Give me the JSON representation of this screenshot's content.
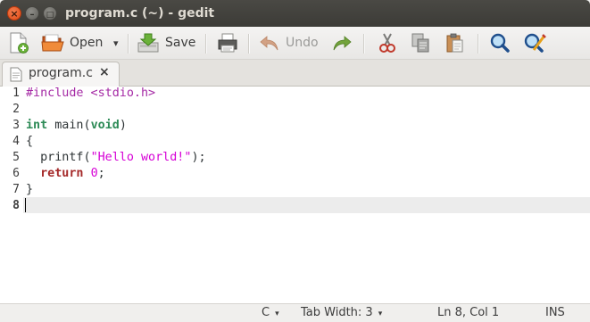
{
  "window": {
    "title": "program.c (~) - gedit",
    "close_glyph": "×",
    "minimize_glyph": "–",
    "maximize_glyph": "□"
  },
  "toolbar": {
    "new_icon": "new-document-icon",
    "open_label": "Open",
    "open_icon": "folder-open-icon",
    "open_dropdown_glyph": "▾",
    "save_label": "Save",
    "save_icon": "save-icon",
    "print_icon": "printer-icon",
    "undo_label": "Undo",
    "undo_icon": "undo-arrow-icon",
    "redo_icon": "redo-arrow-icon",
    "cut_icon": "scissors-icon",
    "copy_icon": "copy-icon",
    "paste_icon": "paste-icon",
    "find_icon": "search-icon",
    "replace_icon": "search-replace-icon"
  },
  "tabs": [
    {
      "label": "program.c",
      "close_glyph": "×",
      "icon": "text-file-icon",
      "active": true
    }
  ],
  "editor": {
    "line_numbers": [
      "1",
      "2",
      "3",
      "4",
      "5",
      "6",
      "7",
      "8"
    ],
    "current_line": "8",
    "lines": [
      {
        "tokens": [
          {
            "t": "#include <stdio.h>",
            "c": "pre"
          }
        ]
      },
      {
        "tokens": []
      },
      {
        "tokens": [
          {
            "t": "int",
            "c": "ty"
          },
          {
            "t": " main(",
            "c": ""
          },
          {
            "t": "void",
            "c": "ty"
          },
          {
            "t": ")",
            "c": ""
          }
        ]
      },
      {
        "tokens": [
          {
            "t": "{",
            "c": ""
          }
        ]
      },
      {
        "tokens": [
          {
            "t": "  printf(",
            "c": ""
          },
          {
            "t": "\"Hello world!\"",
            "c": "str"
          },
          {
            "t": ");",
            "c": ""
          }
        ]
      },
      {
        "tokens": [
          {
            "t": "  ",
            "c": ""
          },
          {
            "t": "return",
            "c": "kw"
          },
          {
            "t": " ",
            "c": ""
          },
          {
            "t": "0",
            "c": "num"
          },
          {
            "t": ";",
            "c": ""
          }
        ]
      },
      {
        "tokens": [
          {
            "t": "}",
            "c": ""
          }
        ]
      },
      {
        "tokens": []
      }
    ],
    "colors": {
      "preprocessor": "#a52aa5",
      "keyword": "#a52a2a",
      "type": "#2e8b57",
      "string": "#d600d6",
      "current_line_bg": "#ececec"
    }
  },
  "statusbar": {
    "language": "C",
    "tab_width": "Tab Width: 3",
    "position": "Ln 8, Col 1",
    "mode": "INS",
    "dropdown_glyph": "▾"
  }
}
